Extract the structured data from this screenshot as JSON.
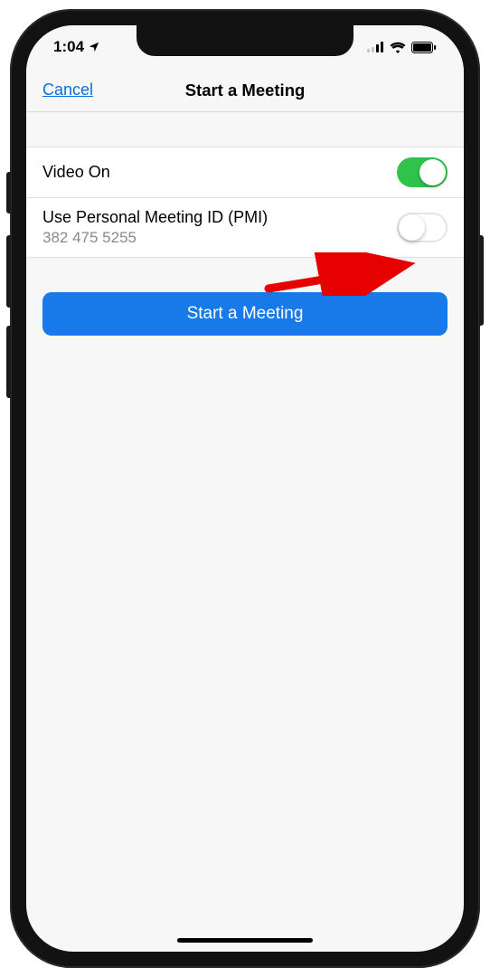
{
  "status": {
    "time": "1:04"
  },
  "nav": {
    "cancel": "Cancel",
    "title": "Start a Meeting"
  },
  "options": {
    "video_label": "Video On",
    "pmi_label": "Use Personal Meeting ID (PMI)",
    "pmi_value": "382 475 5255"
  },
  "action": {
    "start_label": "Start a Meeting"
  }
}
